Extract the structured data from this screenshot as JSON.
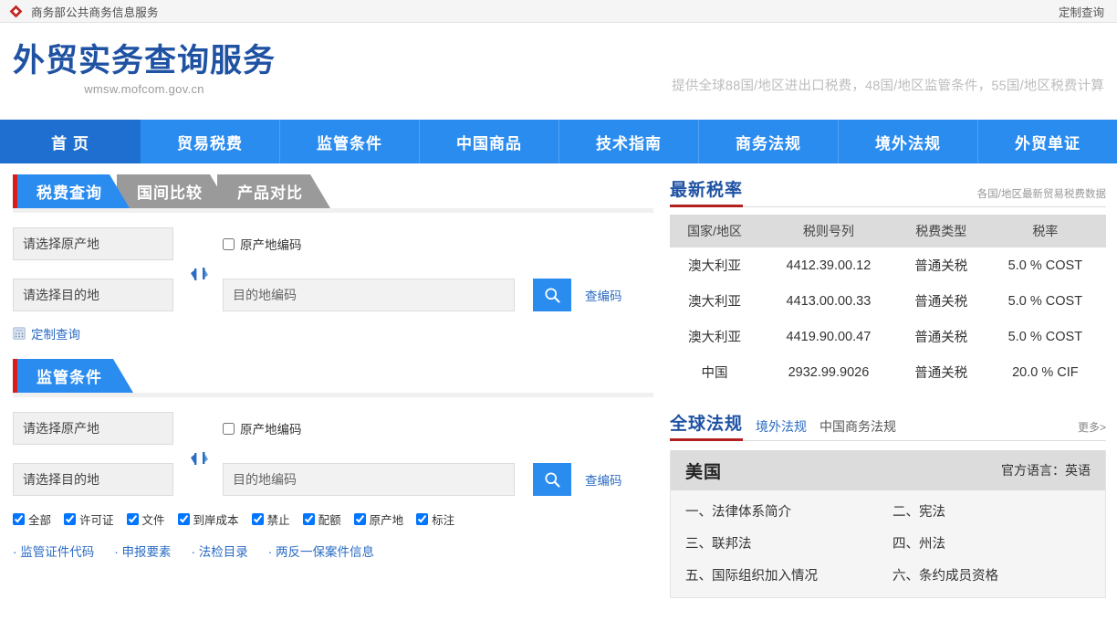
{
  "topbar": {
    "logo_icon": "mofcom-pinwheel-logo",
    "title": "商务部公共商务信息服务",
    "right_link": "定制查询"
  },
  "masthead": {
    "brand_title": "外贸实务查询服务",
    "brand_url": "wmsw.mofcom.gov.cn",
    "slogan": "提供全球88国/地区进出口税费，48国/地区监管条件，55国/地区税费计算"
  },
  "mainnav": {
    "items": [
      {
        "label": "首 页",
        "active": true
      },
      {
        "label": "贸易税费",
        "active": false
      },
      {
        "label": "监管条件",
        "active": false
      },
      {
        "label": "中国商品",
        "active": false
      },
      {
        "label": "技术指南",
        "active": false
      },
      {
        "label": "商务法规",
        "active": false
      },
      {
        "label": "境外法规",
        "active": false
      },
      {
        "label": "外贸单证",
        "active": false
      }
    ]
  },
  "left": {
    "tabs": [
      {
        "label": "税费查询",
        "active": true
      },
      {
        "label": "国间比较",
        "active": false
      },
      {
        "label": "产品对比",
        "active": false
      }
    ],
    "tax_form": {
      "origin_select": "请选择原产地",
      "dest_select": "请选择目的地",
      "origin_code_checkbox_label": "原产地编码",
      "origin_code_checked": false,
      "dest_code_placeholder": "目的地编码",
      "dest_code_value": "",
      "search_icon": "magnifier-icon",
      "code_lookup_link": "查编码",
      "swap_icon": "swap-vertical-icon"
    },
    "custom_query": {
      "icon": "calculator-icon",
      "label": "定制查询"
    },
    "section2_title": "监管条件",
    "reg_form": {
      "origin_select": "请选择原产地",
      "dest_select": "请选择目的地",
      "origin_code_checkbox_label": "原产地编码",
      "origin_code_checked": false,
      "dest_code_placeholder": "目的地编码",
      "dest_code_value": "",
      "search_icon": "magnifier-icon",
      "code_lookup_link": "查编码",
      "swap_icon": "swap-vertical-icon"
    },
    "filters": [
      {
        "label": "全部",
        "checked": true
      },
      {
        "label": "许可证",
        "checked": true
      },
      {
        "label": "文件",
        "checked": true
      },
      {
        "label": "到岸成本",
        "checked": true
      },
      {
        "label": "禁止",
        "checked": true
      },
      {
        "label": "配额",
        "checked": true
      },
      {
        "label": "原产地",
        "checked": true
      },
      {
        "label": "标注",
        "checked": true
      }
    ],
    "quick_links": [
      "监管证件代码",
      "申报要素",
      "法检目录",
      "两反一保案件信息"
    ]
  },
  "right": {
    "rates_panel": {
      "title": "最新税率",
      "hint": "各国/地区最新贸易税费数据",
      "columns": [
        "国家/地区",
        "税则号列",
        "税费类型",
        "税率"
      ],
      "rows": [
        [
          "澳大利亚",
          "4412.39.00.12",
          "普通关税",
          "5.0 % COST"
        ],
        [
          "澳大利亚",
          "4413.00.00.33",
          "普通关税",
          "5.0 % COST"
        ],
        [
          "澳大利亚",
          "4419.90.00.47",
          "普通关税",
          "5.0 % COST"
        ],
        [
          "中国",
          "2932.99.9026",
          "普通关税",
          "20.0 % CIF"
        ]
      ]
    },
    "laws_panel": {
      "title": "全球法规",
      "subtabs": [
        {
          "label": "境外法规",
          "style": "blue"
        },
        {
          "label": "中国商务法规",
          "style": "gray"
        }
      ],
      "more": "更多>",
      "country": "美国",
      "language_label": "官方语言：英语",
      "items": [
        "一、法律体系简介",
        "二、宪法",
        "三、联邦法",
        "四、州法",
        "五、国际组织加入情况",
        "六、条约成员资格"
      ]
    }
  },
  "colors": {
    "brand_blue": "#1f52a3",
    "nav_blue": "#2b8cf0",
    "nav_active_blue": "#1e6fd0",
    "accent_red": "#b32020",
    "tab_gray": "#9a9a9a",
    "link_blue": "#2b6cc4"
  }
}
